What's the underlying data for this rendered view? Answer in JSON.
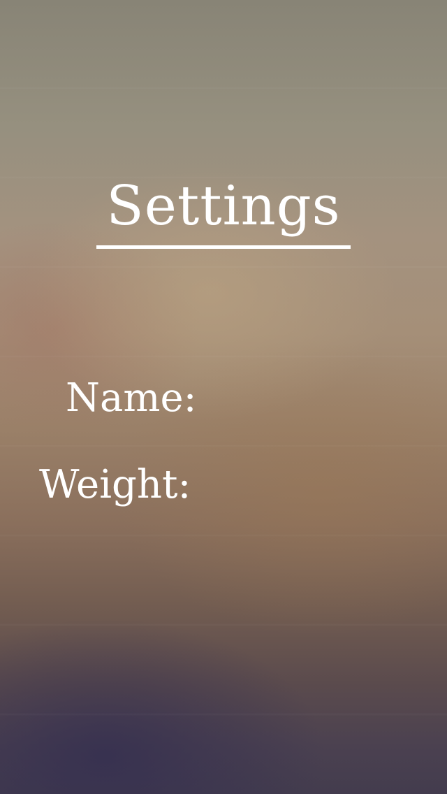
{
  "screen": {
    "title": "Settings"
  },
  "form": {
    "name_label": "Name:",
    "weight_label": "Weight:"
  }
}
